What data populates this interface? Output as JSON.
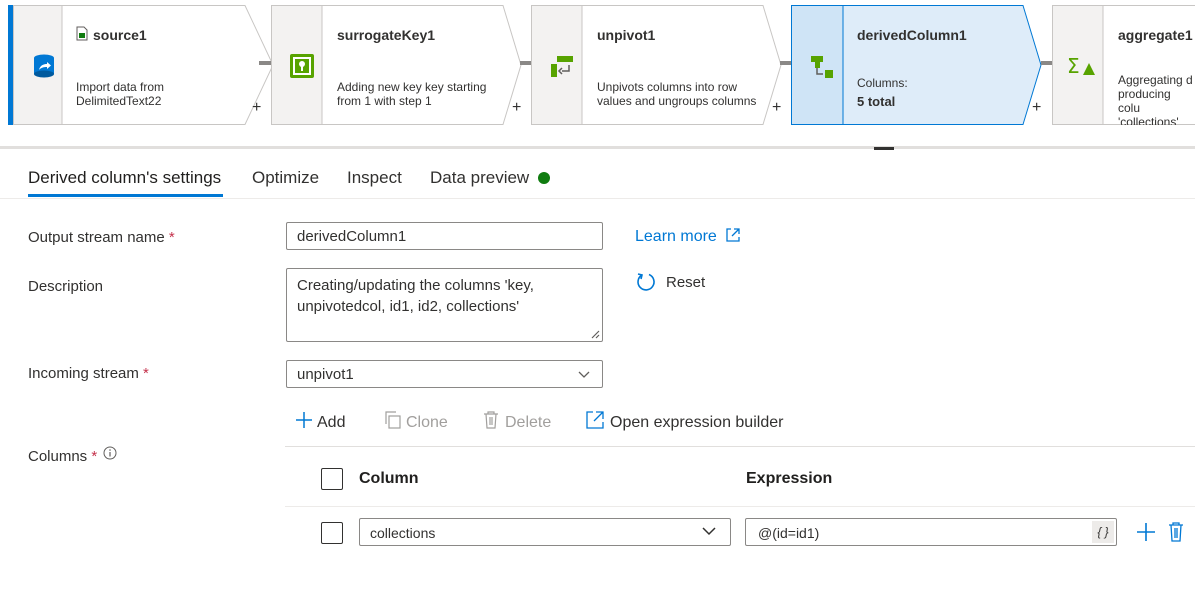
{
  "pipeline": {
    "nodes": [
      {
        "title": "source1",
        "desc": [
          "Import data from",
          "DelimitedText22"
        ]
      },
      {
        "title": "surrogateKey1",
        "desc": [
          "Adding new key key starting",
          "from 1 with step 1"
        ]
      },
      {
        "title": "unpivot1",
        "desc": [
          "Unpivots columns into row",
          "values and ungroups columns"
        ]
      },
      {
        "title": "derivedColumn1",
        "meta_label": "Columns:",
        "meta_value": "5 total"
      },
      {
        "title": "aggregate1",
        "desc": [
          "Aggregating d",
          "producing colu",
          "'collections'"
        ]
      }
    ],
    "plus_label": "+"
  },
  "tabs": [
    {
      "label": "Derived column's settings"
    },
    {
      "label": "Optimize"
    },
    {
      "label": "Inspect"
    },
    {
      "label": "Data preview"
    }
  ],
  "form": {
    "output_stream_label": "Output stream name",
    "output_stream_value": "derivedColumn1",
    "learn_more": "Learn more",
    "description_label": "Description",
    "description_value": "Creating/updating the columns 'key, unpivotedcol, id1, id2, collections'",
    "reset_label": "Reset",
    "incoming_stream_label": "Incoming stream",
    "incoming_stream_value": "unpivot1",
    "columns_label": "Columns",
    "required_mark": "*"
  },
  "columns_toolbar": {
    "add": "Add",
    "clone": "Clone",
    "delete": "Delete",
    "open_builder": "Open expression builder"
  },
  "columns_table": {
    "headers": {
      "column": "Column",
      "expression": "Expression"
    },
    "rows": [
      {
        "column": "collections",
        "expression": "@(id=id1)"
      }
    ],
    "expr_button": "{ }"
  },
  "colors": {
    "accent": "#0078d4",
    "status_green": "#107c10",
    "required": "#c4314b"
  }
}
